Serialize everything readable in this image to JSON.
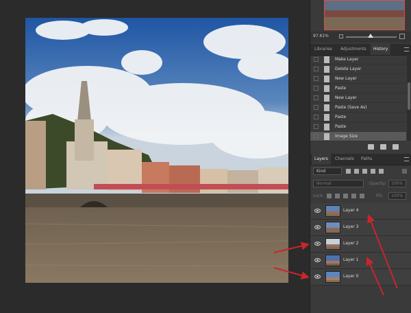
{
  "navigator": {
    "zoom": "97.61%"
  },
  "panel_tabs_top": [
    {
      "label": "Libraries",
      "active": false
    },
    {
      "label": "Adjustments",
      "active": false
    },
    {
      "label": "History",
      "active": true
    }
  ],
  "history": {
    "items": [
      {
        "label": "Make Layer",
        "selected": false
      },
      {
        "label": "Delete Layer",
        "selected": false
      },
      {
        "label": "New Layer",
        "selected": false
      },
      {
        "label": "Paste",
        "selected": false
      },
      {
        "label": "New Layer",
        "selected": false
      },
      {
        "label": "Paste (Save As)",
        "selected": false
      },
      {
        "label": "Paste",
        "selected": false
      },
      {
        "label": "Paste",
        "selected": false
      },
      {
        "label": "Image Size",
        "selected": true
      }
    ]
  },
  "panel_tabs_bottom": [
    {
      "label": "Layers",
      "active": true
    },
    {
      "label": "Channels",
      "active": false
    },
    {
      "label": "Paths",
      "active": false
    }
  ],
  "layers_panel": {
    "filter_kind": "Kind",
    "blend_mode": "Normal",
    "opacity_label": "Opacity:",
    "opacity_value": "100%",
    "lock_label": "Lock:",
    "fill_label": "Fill:",
    "fill_value": "100%",
    "layers": [
      {
        "name": "Layer 4"
      },
      {
        "name": "Layer 3"
      },
      {
        "name": "Layer 2"
      },
      {
        "name": "Layer 1"
      },
      {
        "name": "Layer 0"
      }
    ]
  },
  "colors": {
    "annotation_arrow": "#c8262b",
    "sky": "#2f5f9a",
    "river": "#7a6a55"
  }
}
